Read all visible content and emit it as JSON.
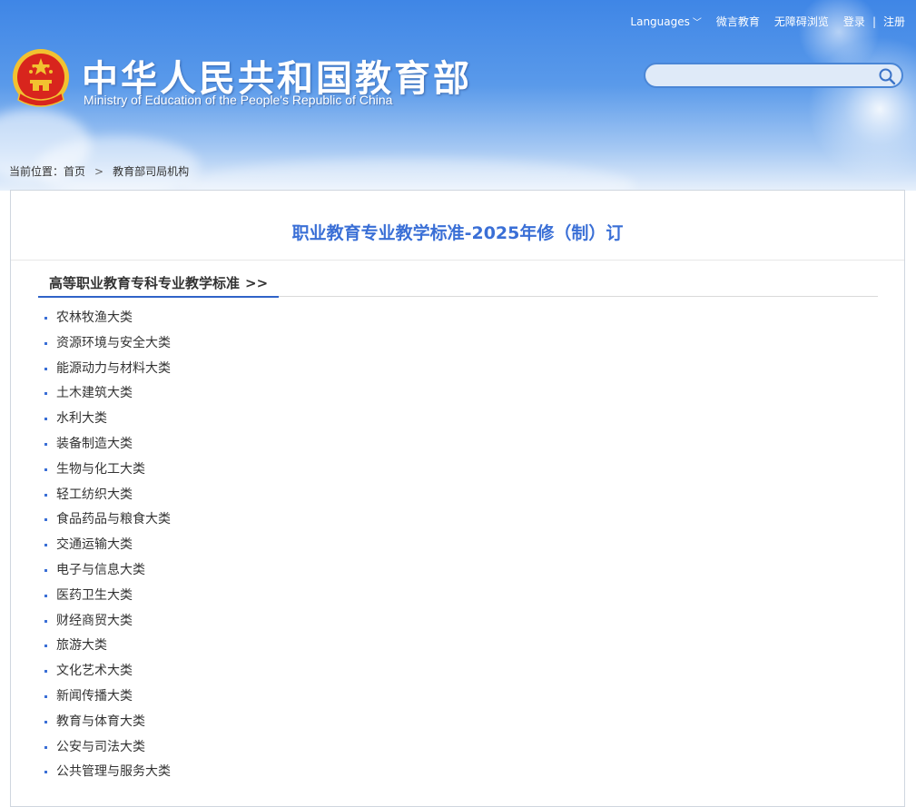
{
  "header": {
    "title_cn": "中华人民共和国教育部",
    "title_en": "Ministry of Education of the People's Republic of China",
    "topnav": {
      "languages": "Languages",
      "weiyan": "微言教育",
      "accessible": "无障碍浏览",
      "login": "登录",
      "separator": "|",
      "register": "注册"
    },
    "search": {
      "placeholder": "",
      "value": ""
    }
  },
  "breadcrumb": {
    "label": "当前位置：",
    "home": "首页",
    "arrow": ">",
    "current": "教育部司局机构"
  },
  "main": {
    "title": "职业教育专业教学标准-2025年修（制）订",
    "section": {
      "title": "高等职业教育专科专业教学标准",
      "more": ">>",
      "items": [
        {
          "label": "农林牧渔大类"
        },
        {
          "label": "资源环境与安全大类"
        },
        {
          "label": "能源动力与材料大类"
        },
        {
          "label": "土木建筑大类"
        },
        {
          "label": "水利大类"
        },
        {
          "label": "装备制造大类"
        },
        {
          "label": "生物与化工大类"
        },
        {
          "label": "轻工纺织大类"
        },
        {
          "label": "食品药品与粮食大类"
        },
        {
          "label": "交通运输大类"
        },
        {
          "label": "电子与信息大类"
        },
        {
          "label": "医药卫生大类"
        },
        {
          "label": "财经商贸大类"
        },
        {
          "label": "旅游大类"
        },
        {
          "label": "文化艺术大类"
        },
        {
          "label": "新闻传播大类"
        },
        {
          "label": "教育与体育大类"
        },
        {
          "label": "公安与司法大类"
        },
        {
          "label": "公共管理与服务大类"
        }
      ]
    }
  },
  "colors": {
    "header_blue": "#3f86e6",
    "title_blue": "#3a6fd6",
    "underline_blue": "#2f63c8",
    "emblem_red": "#d8251d",
    "emblem_gold": "#f2c230"
  },
  "icons": {
    "emblem": "national-emblem-icon",
    "search": "search-icon",
    "dropdown": "chevron-down-icon",
    "bullet": "bullet-icon"
  }
}
